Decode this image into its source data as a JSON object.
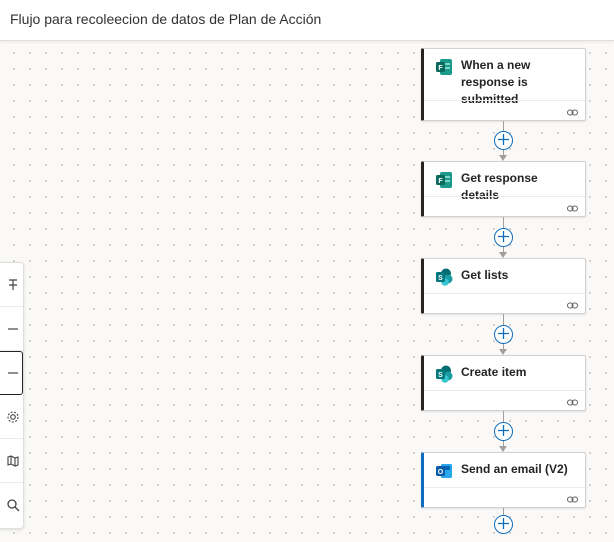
{
  "header": {
    "title": "Flujo para recoleecion de datos de Plan de Acción"
  },
  "toolbar": {
    "items": [
      "minimap-icon",
      "zoom-out-icon",
      "fit-view-icon",
      "settings-icon",
      "map-icon",
      "search-icon"
    ]
  },
  "flow": {
    "steps": [
      {
        "title": "When a new response is submitted",
        "app_icon": "microsoft-forms-icon",
        "accent": "#252423"
      },
      {
        "title": "Get response details",
        "app_icon": "microsoft-forms-icon",
        "accent": "#252423"
      },
      {
        "title": "Get lists",
        "app_icon": "sharepoint-icon",
        "accent": "#252423"
      },
      {
        "title": "Create item",
        "app_icon": "sharepoint-icon",
        "accent": "#252423"
      },
      {
        "title": "Send an email (V2)",
        "app_icon": "outlook-icon",
        "accent": "#0f6cbd"
      }
    ],
    "add_step_icon": "plus-icon",
    "connection_icon": "link-icon"
  },
  "colors": {
    "header_bg": "#ffffff",
    "canvas_bg": "#faf9f8",
    "canvas_dots": "#c8c6c4",
    "card_accent_default": "#252423",
    "card_accent_selected": "#0f6cbd",
    "add_button_border": "#0f6cbd",
    "connector": "#a19f9d"
  }
}
